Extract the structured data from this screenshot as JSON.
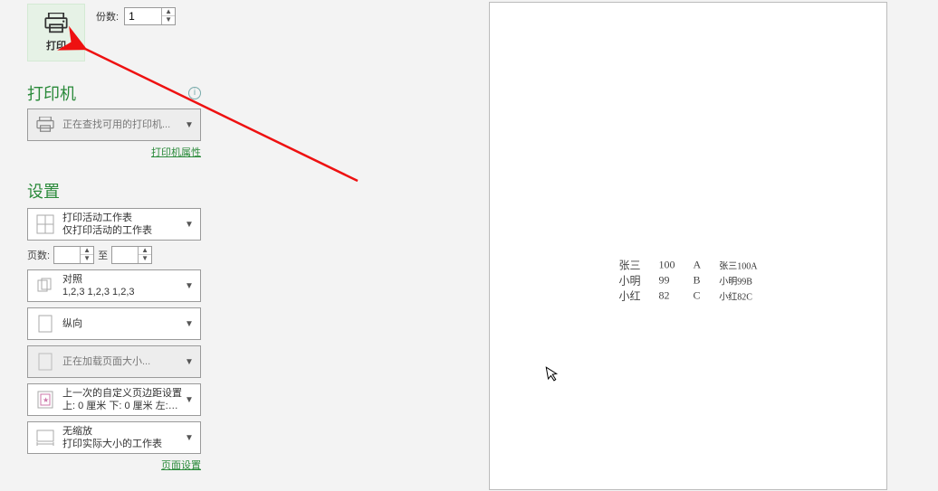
{
  "print": {
    "button_label": "打印",
    "copies_label": "份数:",
    "copies_value": "1"
  },
  "printer_section": {
    "heading": "打印机",
    "status_line": "正在查找可用的打印机...",
    "properties_link": "打印机属性"
  },
  "settings_section": {
    "heading": "设置",
    "print_active": {
      "line1": "打印活动工作表",
      "line2": "仅打印活动的工作表"
    },
    "pages": {
      "label": "页数:",
      "from": "",
      "to_label": "至",
      "to": ""
    },
    "collate": {
      "line1": "对照",
      "line2": "1,2,3    1,2,3    1,2,3"
    },
    "orientation": {
      "line1": "纵向"
    },
    "page_size": {
      "line1": "正在加载页面大小..."
    },
    "margins": {
      "line1": "上一次的自定义页边距设置",
      "line2": "上: 0 厘米 下: 0 厘米 左:…"
    },
    "scaling": {
      "line1": "无缩放",
      "line2": "打印实际大小的工作表"
    },
    "page_setup_link": "页面设置"
  },
  "preview": {
    "rows": [
      {
        "name": "张三",
        "score": "100",
        "grade": "A",
        "concat": "张三100A"
      },
      {
        "name": "小明",
        "score": "99",
        "grade": "B",
        "concat": "小明99B"
      },
      {
        "name": "小红",
        "score": "82",
        "grade": "C",
        "concat": "小红82C"
      }
    ]
  }
}
